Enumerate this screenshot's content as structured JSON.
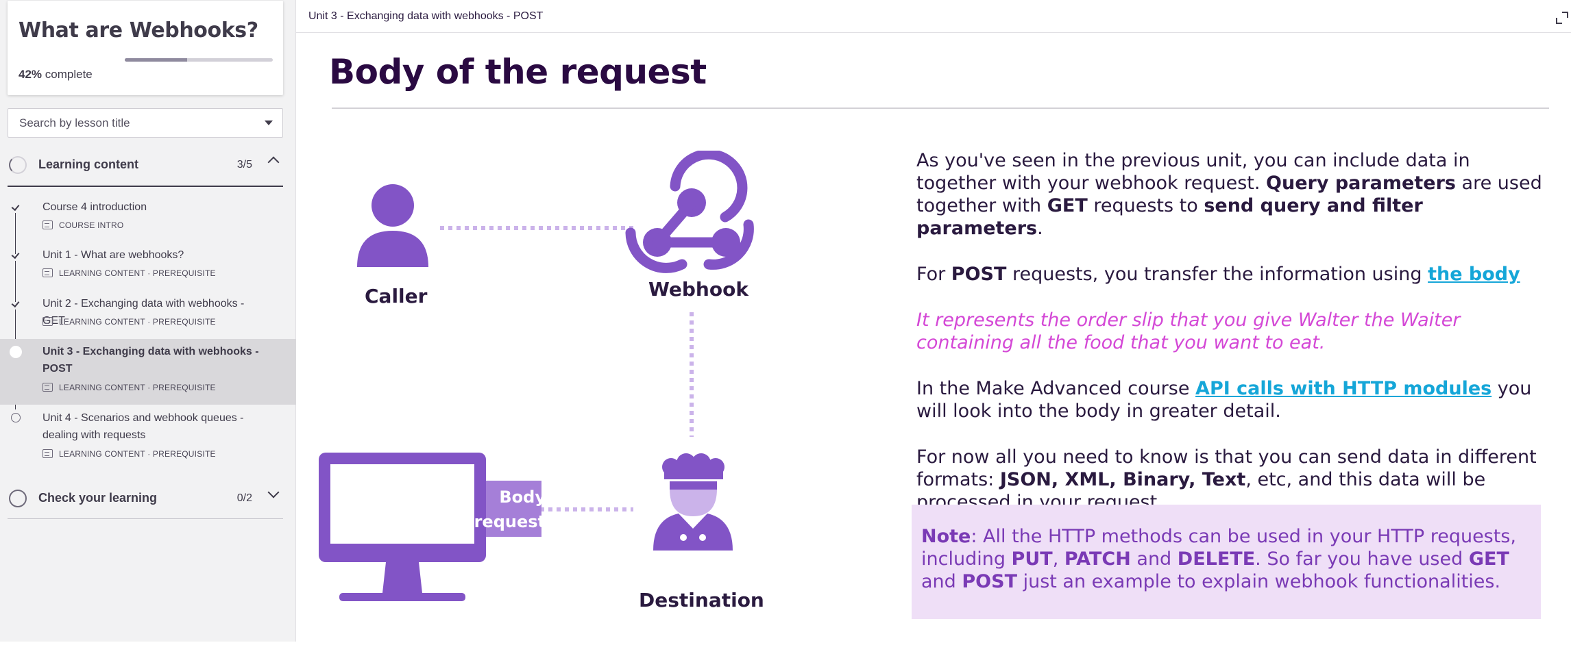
{
  "course": {
    "title": "What are Webhooks?",
    "progress_percent": "42%",
    "progress_suffix": "complete",
    "progress_fraction": 0.42
  },
  "search": {
    "placeholder": "Search by lesson title"
  },
  "sections": [
    {
      "label": "Learning content",
      "count": "3/5",
      "expanded": true
    },
    {
      "label": "Check your learning",
      "count": "0/2",
      "expanded": false
    }
  ],
  "lessons": [
    {
      "title": "Course 4 introduction",
      "meta": "COURSE INTRO",
      "status": "complete"
    },
    {
      "title": "Unit 1 - What are webhooks?",
      "meta": "LEARNING CONTENT · PREREQUISITE",
      "status": "complete"
    },
    {
      "title": "Unit 2 - Exchanging data with webhooks - GET",
      "meta": "LEARNING CONTENT · PREREQUISITE",
      "status": "complete"
    },
    {
      "title": "Unit 3 - Exchanging data with webhooks - POST",
      "meta": "LEARNING CONTENT · PREREQUISITE",
      "status": "current"
    },
    {
      "title": "Unit 4 - Scenarios and webhook queues - dealing with requests",
      "meta": "LEARNING CONTENT · PREREQUISITE",
      "status": "open"
    }
  ],
  "main": {
    "breadcrumb": "Unit 3 - Exchanging data with webhooks - POST",
    "page_title": "Body of the request"
  },
  "diagram": {
    "caller": "Caller",
    "webhook": "Webhook",
    "destination": "Destination",
    "body_line1": "Body",
    "body_line2": "request",
    "accent": "#8254c6",
    "accent_light": "#cbb3ea"
  },
  "content": {
    "p1_a": "As you've seen in the previous unit, you can include data in together with your webhook request. ",
    "p1_b": "Query parameters",
    "p1_c": " are used together with ",
    "p1_d": "GET",
    "p1_e": " requests to ",
    "p1_f": "send query and filter parameters",
    "p1_g": ".",
    "p2_a": "For ",
    "p2_b": "POST",
    "p2_c": " requests, you transfer the information using ",
    "p2_link": "the body",
    "p3": "It represents the order slip that you give Walter the Waiter containing all the food that you want to eat.",
    "p4_a": "In the Make Advanced course ",
    "p4_link": "API calls with HTTP modules",
    "p4_b": " you will look into the body in greater detail.",
    "p5_a": "For now all you need to know is that you can send data in different formats: ",
    "p5_b": "JSON, XML, Binary, Text",
    "p5_c": ", etc, and this data will be processed in your request."
  },
  "note": {
    "label": "Note",
    "t1": ": All the HTTP methods can be used in your HTTP requests, including  ",
    "put": "PUT",
    "sep1": ", ",
    "patch": "PATCH",
    "t2": " and ",
    "delete": "DELETE",
    "t3": ". So far you have used ",
    "get": "GET",
    "t4": " and ",
    "post": "POST",
    "t5": " just an example to explain webhook functionalities."
  }
}
